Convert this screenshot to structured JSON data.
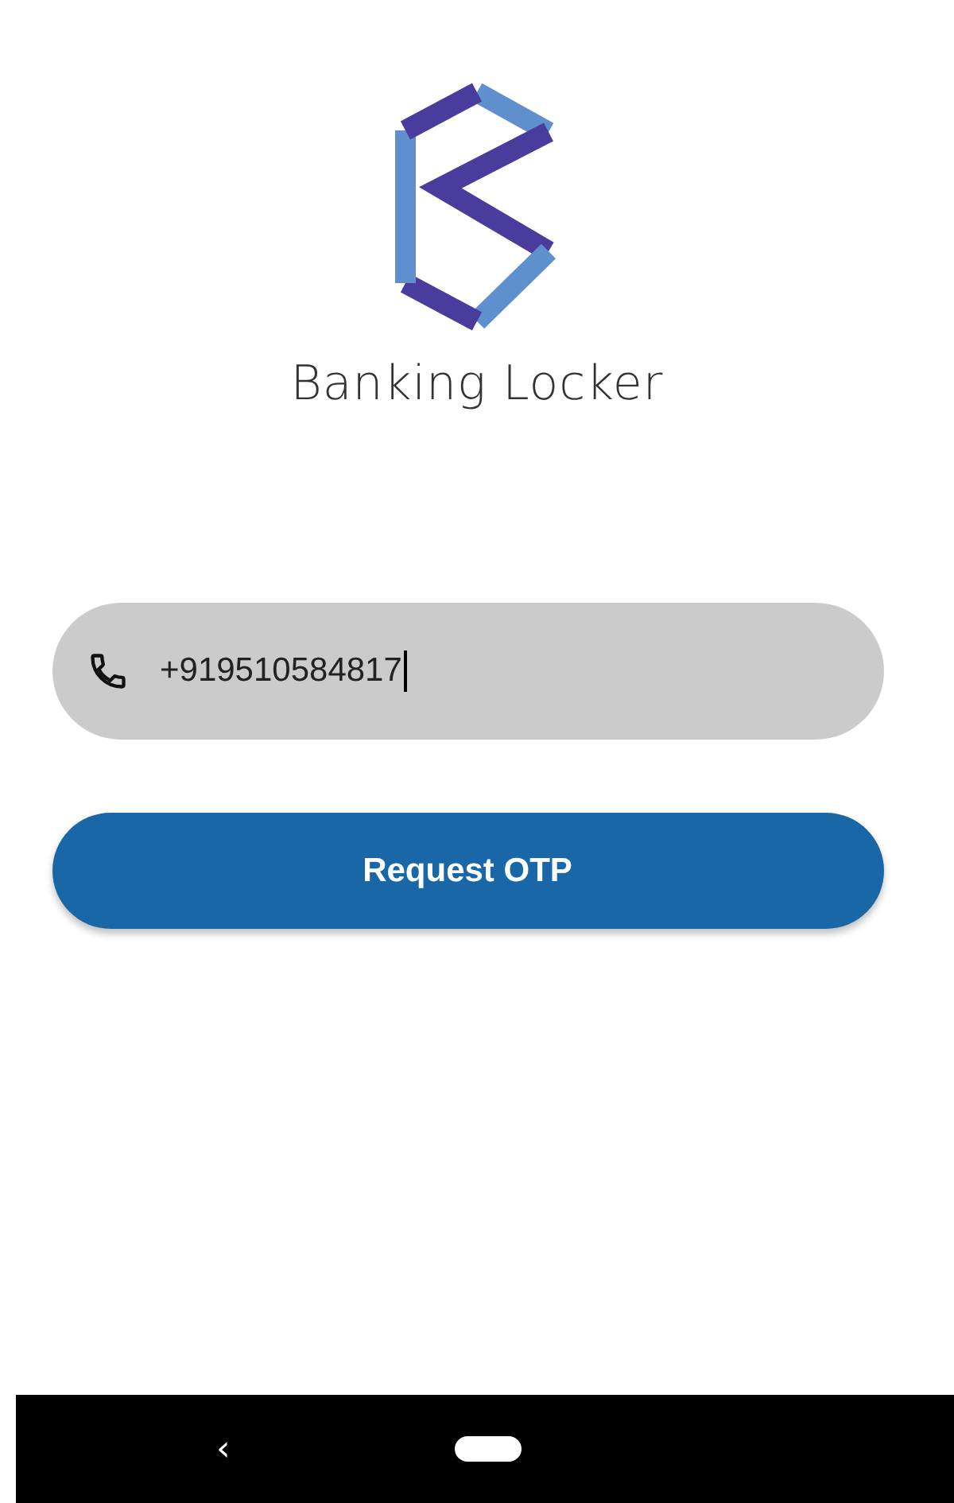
{
  "app_name": "Banking Locker",
  "phone_field": {
    "value": "+919510584817",
    "focused": true
  },
  "button": {
    "label": "Request OTP"
  },
  "nav_bar": {
    "back": "‹"
  }
}
